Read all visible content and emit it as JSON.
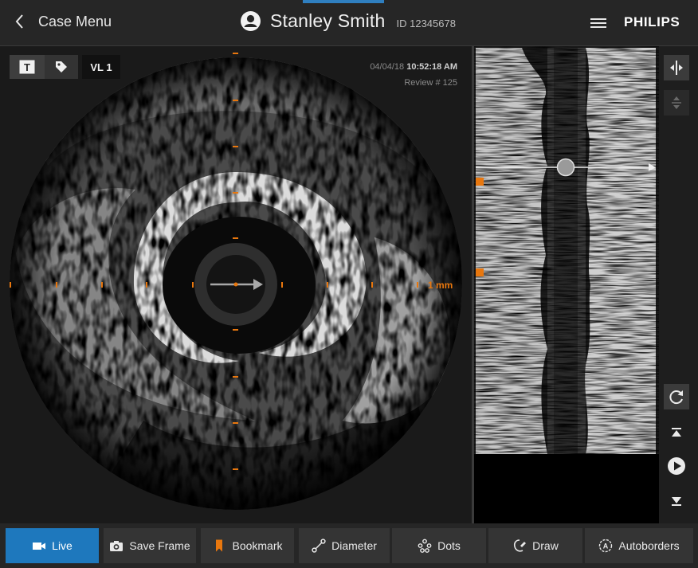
{
  "header": {
    "back_label": "Case Menu",
    "patient_name": "Stanley Smith",
    "patient_id": "ID 12345678",
    "brand": "PHILIPS",
    "icons": [
      "chevron-left-icon",
      "user-avatar-icon",
      "hamburger-menu-icon"
    ]
  },
  "viewer": {
    "text_tool_glyph": "T",
    "vessel_label": "VL 1",
    "date": "04/04/18",
    "time": "10:52:18 AM",
    "review": "Review # 125",
    "scale_label": "1 mm"
  },
  "colors": {
    "accent_blue": "#1e78bd",
    "marker_orange": "#e8770e",
    "header_bg": "#262626",
    "button_bg": "#343434"
  },
  "right_rail": {
    "icons": [
      "split-view-icon",
      "align-icon",
      "refresh-icon",
      "skip-to-start-icon",
      "play-icon",
      "skip-to-end-icon"
    ]
  },
  "toolbar": {
    "buttons": [
      {
        "label": "Live",
        "icon": "video-camera-icon",
        "active": true
      },
      {
        "label": "Save Frame",
        "icon": "camera-icon"
      },
      {
        "label": "Bookmark",
        "icon": "bookmark-icon"
      },
      {
        "label": "Diameter",
        "icon": "diameter-icon"
      },
      {
        "label": "Dots",
        "icon": "dots-icon"
      },
      {
        "label": "Draw",
        "icon": "draw-icon"
      },
      {
        "label": "Autoborders",
        "icon": "autoborders-icon"
      }
    ]
  }
}
